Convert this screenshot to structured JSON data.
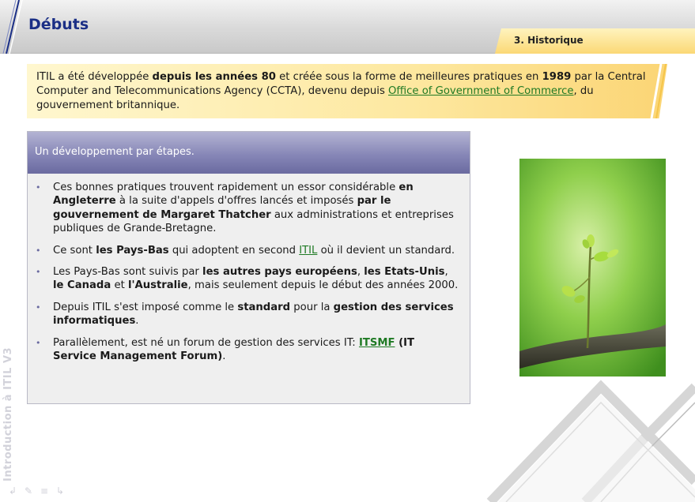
{
  "header": {
    "title": "Débuts",
    "section_tab": "3. Historique"
  },
  "intro": {
    "t1": "ITIL a été développée ",
    "b1": "depuis les années 80",
    "t2": " et créée sous la forme de meilleures pratiques en ",
    "b2": "1989",
    "t3": " par la Central Computer and Telecommunications Agency (CCTA), devenu depuis ",
    "link": "Office of Government of Commerce",
    "t4": ", du gouvernement britannique."
  },
  "panel": {
    "heading": "Un développement par étapes.",
    "bullet_symbol": "•",
    "items": [
      {
        "t1": "Ces bonnes pratiques trouvent rapidement un essor considérable ",
        "b1": "en Angleterre",
        "t2": " à la suite d'appels d'offres lancés et imposés ",
        "b2": "par le gouvernement de Margaret Thatcher",
        "t3": " aux administrations et entreprises publiques de Grande-Bretagne."
      },
      {
        "t1": "Ce sont ",
        "b1": "les Pays-Bas",
        "t2": " qui adoptent en second ",
        "link": "ITIL",
        "t3": " où il devient un standard."
      },
      {
        "t1": "Les Pays-Bas sont suivis par ",
        "b1": "les autres pays européens",
        "t2": ", ",
        "b2": "les Etats-Unis",
        "t3": ", ",
        "b3": "le Canada",
        "t4": " et ",
        "b4": "l'Australie",
        "t5": ", mais seulement depuis le début des années 2000."
      },
      {
        "t1": "Depuis ITIL s'est imposé comme le ",
        "b1": "standard",
        "t2": " pour la ",
        "b2": "gestion des services informatiques",
        "t3": "."
      },
      {
        "t1": "Parallèlement, est né un forum de gestion des services IT: ",
        "link": "ITSMF",
        "b1": " (IT Service Management Forum)",
        "t2": "."
      }
    ]
  },
  "side": {
    "label": "Introduction à ITIL V3"
  },
  "colors": {
    "title": "#1b2f86",
    "link": "#1f7a24",
    "panel_header": "#8787b7",
    "intro_bg": "#fde8a0"
  },
  "icons": [
    "back-arrow-icon",
    "pen-icon",
    "menu-icon",
    "forward-arrow-icon"
  ]
}
